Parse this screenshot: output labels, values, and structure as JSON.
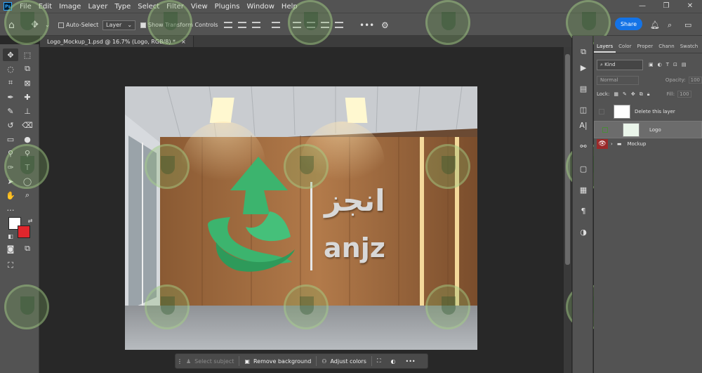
{
  "menubar": {
    "app_icon": "Ps",
    "items": [
      "File",
      "Edit",
      "Image",
      "Layer",
      "Type",
      "Select",
      "Filter",
      "View",
      "Plugins",
      "Window",
      "Help"
    ]
  },
  "window_controls": [
    "minimize-icon",
    "restore-icon",
    "close-icon"
  ],
  "options": {
    "auto_select_label": "Auto-Select",
    "auto_select_checked": false,
    "target_value": "Layer",
    "transform_label": "Show Transform Controls",
    "transform_checked": true,
    "share_label": "Share"
  },
  "document_tab": {
    "title": "Logo_Mockup_1.psd @ 16.7% (Logo, RGB/8) *",
    "close": "×"
  },
  "canvas": {
    "logo_arabic": "انجز",
    "logo_latin": "anjz"
  },
  "context_bar": {
    "select_subject": "Select subject",
    "remove_background": "Remove background",
    "adjust_colors": "Adjust colors"
  },
  "panel": {
    "tabs": [
      "Layers",
      "Color",
      "Proper",
      "Chann",
      "Swatch"
    ],
    "active_tab": "Layers",
    "filter_kind": "Kind",
    "blend_mode": "Normal",
    "opacity_label": "Opacity:",
    "opacity_value": "100",
    "lock_label": "Lock:",
    "fill_label": "Fill:",
    "fill_value": "100",
    "layers": [
      {
        "name": "Delete this layer",
        "visible": false,
        "selected": false
      },
      {
        "name": "Logo",
        "visible": false,
        "selected": true
      },
      {
        "name": "Mockup",
        "visible": true,
        "selected": false,
        "group": true
      }
    ]
  },
  "colors": {
    "accent": "#1473e6",
    "foreground": "#ffffff",
    "background": "#e0262c",
    "logo_green": "#3cb46e"
  }
}
